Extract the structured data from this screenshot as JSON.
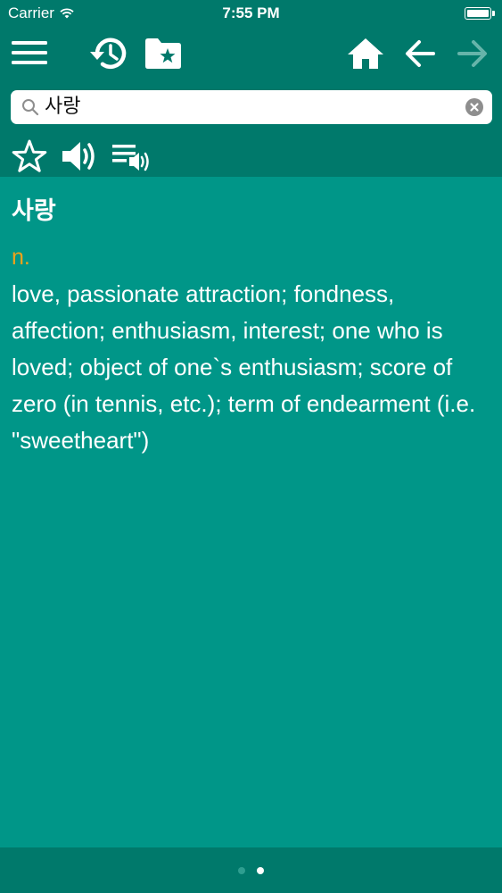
{
  "status": {
    "carrier": "Carrier",
    "time": "7:55 PM"
  },
  "toolbar": {
    "icons": [
      "menu-icon",
      "history-icon",
      "favorites-folder-icon",
      "home-icon",
      "back-arrow-icon",
      "forward-arrow-icon"
    ]
  },
  "search": {
    "value": "사랑",
    "placeholder": ""
  },
  "actions": {
    "icons": [
      "star-icon",
      "speaker-icon",
      "playlist-audio-icon"
    ]
  },
  "entry": {
    "headword": "사랑",
    "part_of_speech": "n.",
    "definition": "love, passionate attraction; fondness, affection; enthusiasm, interest; one who is loved; object of one`s enthusiasm; score of zero (in tennis, etc.); term of endearment (i.e. \"sweetheart\")"
  },
  "pager": {
    "page_count": 2,
    "current_page": 2
  },
  "colors": {
    "background": "#009688",
    "bar": "#00796b",
    "part_of_speech": "#f0a21a",
    "disabled_icon": "#66b4aa"
  }
}
